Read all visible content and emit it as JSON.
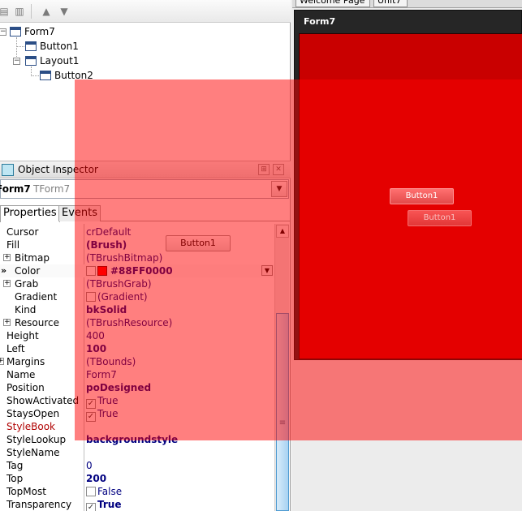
{
  "tree": {
    "nodes": [
      {
        "label": "Form7",
        "level": 0
      },
      {
        "label": "Button1",
        "level": 1
      },
      {
        "label": "Layout1",
        "level": 1
      },
      {
        "label": "Button2",
        "level": 2
      }
    ]
  },
  "right_tabs": [
    "Welcome Page",
    "Unit7"
  ],
  "inspector": {
    "title": "Object Inspector",
    "selected_name": "Form7",
    "selected_type": "TForm7",
    "tabs": [
      "Properties",
      "Events"
    ],
    "properties": [
      {
        "name": "Cursor",
        "value": "crDefault"
      },
      {
        "name": "Fill",
        "value": "(Brush)"
      },
      {
        "name": "Bitmap",
        "value": "(TBrushBitmap)"
      },
      {
        "name": "Color",
        "value": "#88FF0000"
      },
      {
        "name": "Grab",
        "value": "(TBrushGrab)"
      },
      {
        "name": "Gradient",
        "value": "(Gradient)"
      },
      {
        "name": "Kind",
        "value": "bkSolid"
      },
      {
        "name": "Resource",
        "value": "(TBrushResource)"
      },
      {
        "name": "Height",
        "value": "400"
      },
      {
        "name": "Left",
        "value": "100"
      },
      {
        "name": "Margins",
        "value": "(TBounds)"
      },
      {
        "name": "Name",
        "value": "Form7"
      },
      {
        "name": "Position",
        "value": "poDesigned"
      },
      {
        "name": "ShowActivated",
        "value": "True"
      },
      {
        "name": "StaysOpen",
        "value": "True"
      },
      {
        "name": "StyleBook",
        "value": ""
      },
      {
        "name": "StyleLookup",
        "value": "backgroundstyle"
      },
      {
        "name": "StyleName",
        "value": ""
      },
      {
        "name": "Tag",
        "value": "0"
      },
      {
        "name": "Top",
        "value": "200"
      },
      {
        "name": "TopMost",
        "value": "False"
      },
      {
        "name": "Transparency",
        "value": "True"
      }
    ],
    "inline_button": "Button1"
  },
  "designer": {
    "form_caption": "Form7",
    "button_a": "Button1",
    "button_b": "Button1"
  },
  "colors": {
    "form_fill": "#c90000",
    "overlay": "#88FF0000"
  }
}
